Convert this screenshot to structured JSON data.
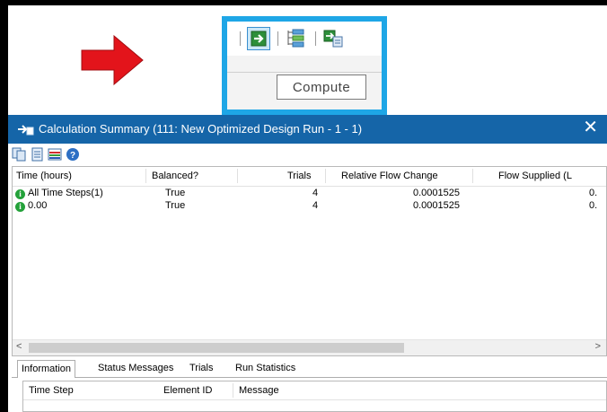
{
  "annotation": {
    "arrow_color": "#e3141b",
    "highlight_color": "#1ea6e6"
  },
  "toolbar_callout": {
    "buttons": [
      "compute-icon",
      "element-tree-icon",
      "copy-results-icon"
    ],
    "tooltip": "Compute"
  },
  "window": {
    "title": "Calculation Summary (111: New Optimized Design Run - 1 - 1)",
    "close_glyph": "✕",
    "title_color": "#1565a8",
    "toolbar_icons": [
      "copy-icon",
      "report-icon",
      "graph-icon",
      "help-icon"
    ]
  },
  "grid": {
    "columns": [
      "Time (hours)",
      "Balanced?",
      "Trials",
      "Relative Flow Change",
      "Flow Supplied (L"
    ],
    "rows": [
      {
        "time": "All Time Steps(1)",
        "balanced": "True",
        "trials": "4",
        "rel_flow_change": "0.0001525",
        "flow_supplied": "0."
      },
      {
        "time": "0.00",
        "balanced": "True",
        "trials": "4",
        "rel_flow_change": "0.0001525",
        "flow_supplied": "0."
      }
    ],
    "scroll_left": "<",
    "scroll_right": ">"
  },
  "tabs": [
    "Information",
    "Status Messages",
    "Trials",
    "Run Statistics"
  ],
  "detail": {
    "columns": [
      "Time Step",
      "Element ID",
      "Message"
    ]
  }
}
